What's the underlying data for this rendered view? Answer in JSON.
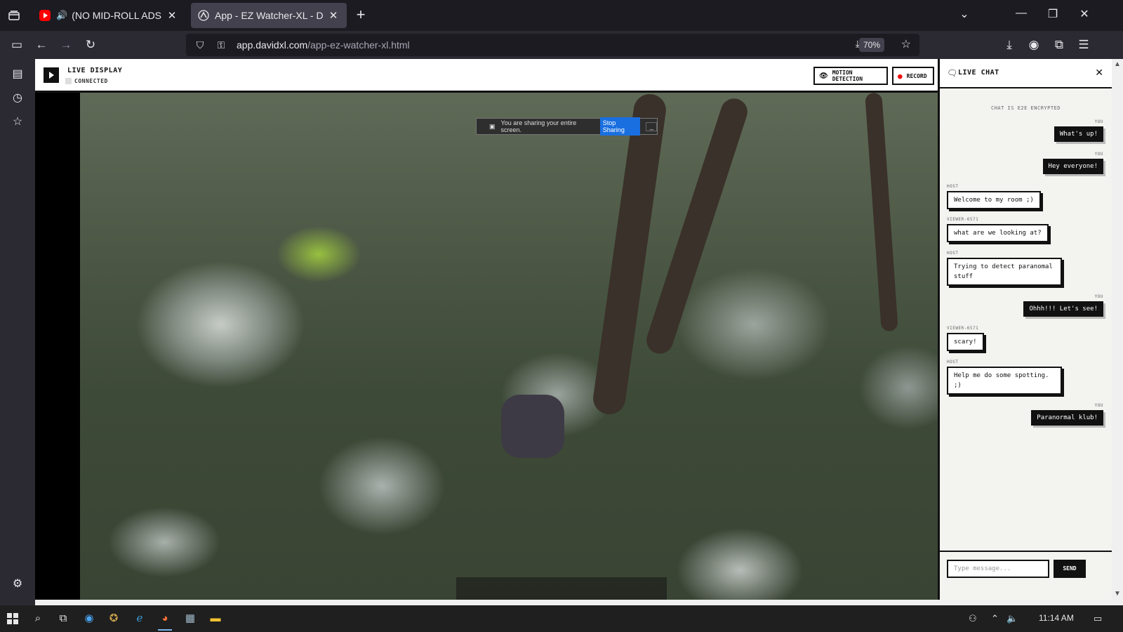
{
  "browser": {
    "tabs": [
      {
        "title": "(NO MID-ROLL ADS) 🌷 So",
        "favicon": "youtube-icon",
        "audio": "speaker-icon"
      },
      {
        "title": "App - EZ Watcher-XL - DavidXL",
        "favicon": "davidxl-icon"
      }
    ],
    "url_domain": "app.davidxl.com",
    "url_path": "/app-ez-watcher-xl.html",
    "zoom": "70%"
  },
  "app": {
    "display_label": "LIVE DISPLAY",
    "connection_status": "CONNECTED",
    "motion_button": "MOTION DETECTION",
    "record_button": "RECORD",
    "screen_share": {
      "notice": "You are sharing your entire screen.",
      "stop_label": "Stop Sharing",
      "minimize_label": "_"
    }
  },
  "chat": {
    "title": "LIVE CHAT",
    "encryption_note": "CHAT IS E2E ENCRYPTED",
    "messages": [
      {
        "sender": "YOU",
        "text": "What's up!"
      },
      {
        "sender": "YOU",
        "text": "Hey everyone!"
      },
      {
        "sender": "HOST",
        "text": "Welcome to my room ;)"
      },
      {
        "sender": "VIEWER-6571",
        "text": "what are we looking at?"
      },
      {
        "sender": "HOST",
        "text": "Trying to detect paranomal stuff"
      },
      {
        "sender": "YOU",
        "text": "Ohhh!!! Let's see!"
      },
      {
        "sender": "VIEWER-6571",
        "text": "scary!"
      },
      {
        "sender": "HOST",
        "text": "Help me do some spotting. ;)"
      },
      {
        "sender": "YOU",
        "text": "Paranormal klub!"
      }
    ],
    "input_placeholder": "Type message...",
    "send_label": "SEND"
  },
  "taskbar": {
    "clock": "11:14 AM"
  },
  "colors": {
    "browser_bg": "#1c1b22",
    "toolbar_bg": "#2b2a33",
    "app_ink": "#111111",
    "record_dot": "#ee1111",
    "share_button": "#1a6fe0"
  }
}
